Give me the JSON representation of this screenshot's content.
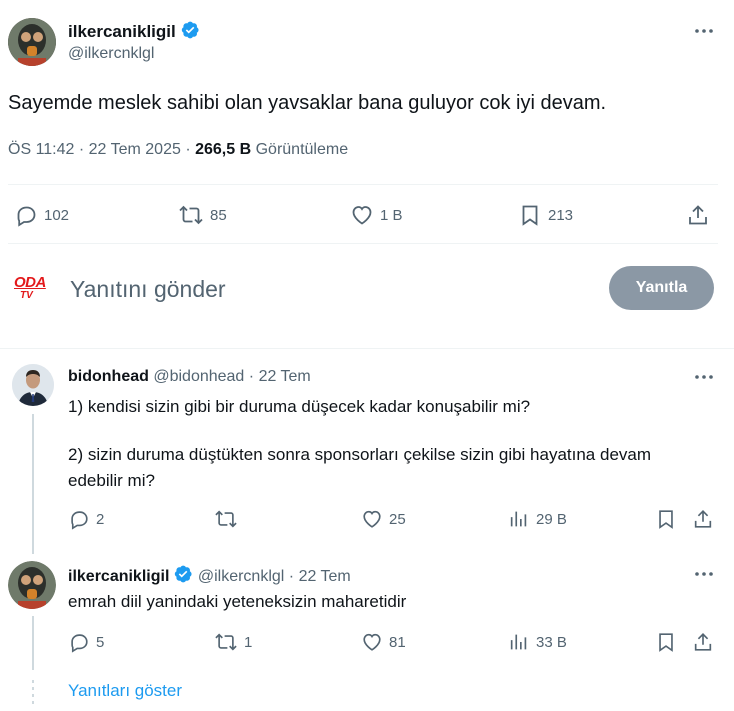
{
  "tweet": {
    "author_name": "ilkercanikligil",
    "author_handle": "@ilkercnklgl",
    "text": "Sayemde meslek sahibi olan yavsaklar bana guluyor cok iyi devam.",
    "time": "ÖS 11:42",
    "date": "22 Tem 2025",
    "views_count": "266,5 B",
    "views_label": "Görüntüleme",
    "replies": "102",
    "retweets": "85",
    "likes": "1 B",
    "bookmarks": "213"
  },
  "compose": {
    "logo_text_top": "ODA",
    "logo_text_bottom": "TV",
    "placeholder": "Yanıtını gönder",
    "button_label": "Yanıtla"
  },
  "replies": [
    {
      "author_name": "bidonhead",
      "author_handle": "@bidonhead",
      "date": "22 Tem",
      "text_line1": "1) kendisi sizin gibi bir duruma düşecek kadar konuşabilir mi?",
      "text_line2": "2) sizin duruma düştükten sonra sponsorları çekilse sizin gibi hayatına devam edebilir mi?",
      "replies": "2",
      "retweets": "",
      "likes": "25",
      "views": "29 B"
    },
    {
      "author_name": "ilkercanikligil",
      "author_handle": "@ilkercnklgl",
      "date": "22 Tem",
      "text": "emrah diil yanindaki yeteneksizin maharetidir",
      "replies": "5",
      "retweets": "1",
      "likes": "81",
      "views": "33 B"
    }
  ],
  "show_replies_label": "Yanıtları göster",
  "colors": {
    "accent": "#1d9bf0",
    "text": "#0f1419",
    "muted": "#536471",
    "divider": "#eff3f4",
    "reply_button_bg": "#8b98a5",
    "oda_red": "#e3191b"
  }
}
